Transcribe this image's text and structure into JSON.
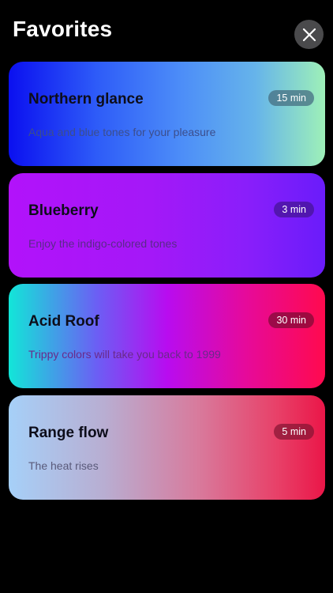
{
  "header": {
    "title": "Favorites",
    "close_icon": "close-icon"
  },
  "cards": [
    {
      "title": "Northern glance",
      "description": "Aqua and blue tones for your pleasure",
      "duration": "15 min",
      "gradient": [
        "#0b10f0",
        "#4d8ef8",
        "#9ef0b8"
      ]
    },
    {
      "title": "Blueberry",
      "description": "Enjoy the indigo-colored tones",
      "duration": "3 min",
      "gradient": [
        "#b212fa",
        "#8a1efa",
        "#6a1cfa"
      ]
    },
    {
      "title": "Acid Roof",
      "description": "Trippy colors will take you back to 1999",
      "duration": "30 min",
      "gradient": [
        "#12e6d8",
        "#b80cf0",
        "#ff0a4e"
      ]
    },
    {
      "title": "Range flow",
      "description": "The heat rises",
      "duration": "5 min",
      "gradient": [
        "#a6d0f8",
        "#d87a9c",
        "#ea1648"
      ]
    }
  ],
  "colors": {
    "background": "#000000",
    "close_button": "#4a4a4c"
  }
}
